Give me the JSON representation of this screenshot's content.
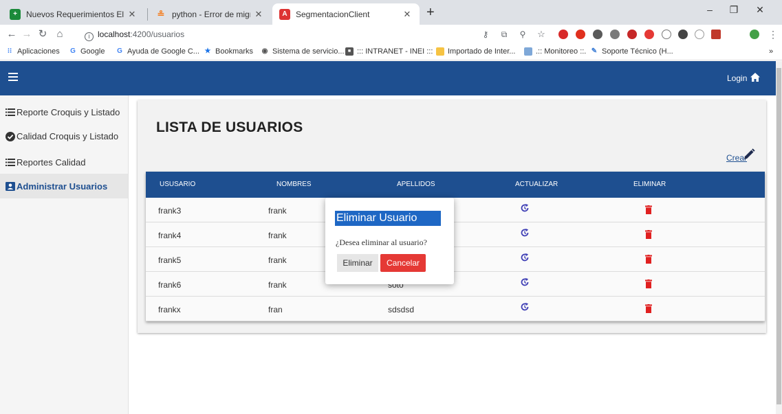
{
  "browser": {
    "tabs": [
      {
        "title": "Nuevos Requerimientos Elegajo ·",
        "icon": "plus-square-icon"
      },
      {
        "title": "python - Error de migración de D",
        "icon": "stackoverflow-icon"
      },
      {
        "title": "SegmentacionClient",
        "icon": "angular-icon"
      }
    ],
    "new_tab": "+",
    "window_controls": {
      "minimize": "–",
      "restore": "❐",
      "close": "✕"
    },
    "address": {
      "host": "localhost",
      "path": ":4200/usuarios"
    },
    "bookmarks": [
      {
        "label": "Aplicaciones",
        "icon": "apps-grid-icon"
      },
      {
        "label": "Google",
        "icon": "google-icon"
      },
      {
        "label": "Ayuda de Google C...",
        "icon": "google-icon"
      },
      {
        "label": "Bookmarks",
        "icon": "star-icon"
      },
      {
        "label": "Sistema de servicio...",
        "icon": "globe-icon"
      },
      {
        "label": "::: INTRANET - INEI :::",
        "icon": "inei-icon"
      },
      {
        "label": "Importado de Inter...",
        "icon": "folder-icon"
      },
      {
        "label": ".:: Monitoreo ::.",
        "icon": "chart-image-icon"
      },
      {
        "label": "Soporte Técnico (H...",
        "icon": "support-icon"
      }
    ],
    "bookmarks_overflow": "»"
  },
  "app": {
    "header": {
      "login_label": "Login"
    },
    "sidebar": [
      {
        "label": "Reporte Croquis y Listado",
        "icon": "list-icon"
      },
      {
        "label": "Calidad Croquis y Listado",
        "icon": "check-circle-icon"
      },
      {
        "label": "Reportes Calidad",
        "icon": "list-icon"
      },
      {
        "label": "Administrar Usuarios",
        "icon": "user-card-icon"
      }
    ],
    "page_title": "LISTA DE USUARIOS",
    "crear_label": "Crear",
    "table": {
      "columns": [
        "USUSARIO",
        "NOMBRES",
        "APELLIDOS",
        "ACTUALIZAR",
        "ELIMINAR"
      ],
      "rows": [
        {
          "usuario": "frank3",
          "nombres": "frank",
          "apellidos": ""
        },
        {
          "usuario": "frank4",
          "nombres": "frank",
          "apellidos": ""
        },
        {
          "usuario": "frank5",
          "nombres": "frank",
          "apellidos": ""
        },
        {
          "usuario": "frank6",
          "nombres": "frank",
          "apellidos": "soto"
        },
        {
          "usuario": "frankx",
          "nombres": "fran",
          "apellidos": "sdsdsd"
        }
      ]
    },
    "modal": {
      "title": "Eliminar Usuario",
      "message": "¿Desea eliminar al usuario?",
      "confirm_label": "Eliminar",
      "cancel_label": "Cancelar"
    },
    "colors": {
      "primary": "#1e4f90",
      "danger": "#e53935",
      "modal_title_bg": "#1e67c4"
    }
  }
}
